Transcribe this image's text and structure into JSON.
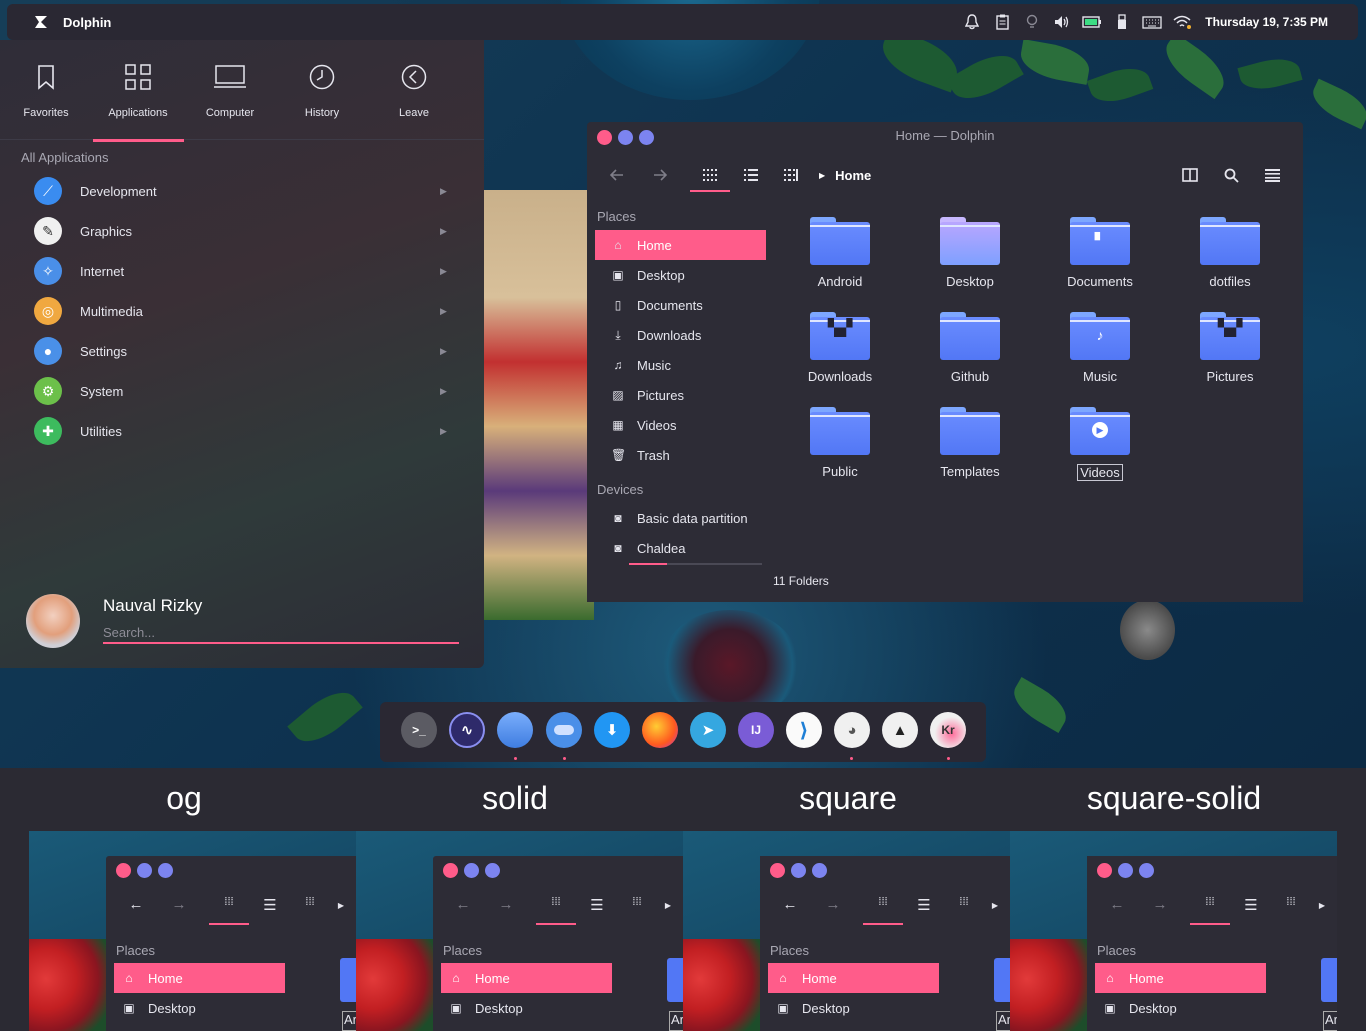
{
  "panel": {
    "app_title": "Dolphin",
    "clock": "Thursday 19,  7:35 PM",
    "tray_icons": [
      "bell-icon",
      "clipboard-icon",
      "lightbulb-icon",
      "volume-icon",
      "battery-icon",
      "usb-icon",
      "keyboard-icon",
      "wifi-icon"
    ]
  },
  "launcher": {
    "tabs": [
      {
        "label": "Favorites",
        "icon": "bookmark-icon"
      },
      {
        "label": "Applications",
        "icon": "grid-icon"
      },
      {
        "label": "Computer",
        "icon": "monitor-icon"
      },
      {
        "label": "History",
        "icon": "clock-icon"
      },
      {
        "label": "Leave",
        "icon": "back-circle-icon"
      }
    ],
    "active_tab": "Applications",
    "section_title": "All Applications",
    "categories": [
      {
        "label": "Development",
        "icon": "development-icon",
        "color": "#3a8cf0"
      },
      {
        "label": "Graphics",
        "icon": "graphics-icon",
        "color": "#f0f0f0"
      },
      {
        "label": "Internet",
        "icon": "internet-icon",
        "color": "#4a8fe8"
      },
      {
        "label": "Multimedia",
        "icon": "multimedia-icon",
        "color": "#f0a840"
      },
      {
        "label": "Settings",
        "icon": "settings-toggle-icon",
        "color": "#4a90e8"
      },
      {
        "label": "System",
        "icon": "system-gear-icon",
        "color": "#6cc04a"
      },
      {
        "label": "Utilities",
        "icon": "utilities-icon",
        "color": "#3dbb5e"
      }
    ],
    "user_name": "Nauval Rizky",
    "search_placeholder": "Search..."
  },
  "dolphin": {
    "window_title": "Home — Dolphin",
    "breadcrumb": "Home",
    "places_header": "Places",
    "places": [
      {
        "label": "Home",
        "icon": "home-icon"
      },
      {
        "label": "Desktop",
        "icon": "desktop-icon"
      },
      {
        "label": "Documents",
        "icon": "document-icon"
      },
      {
        "label": "Downloads",
        "icon": "download-icon"
      },
      {
        "label": "Music",
        "icon": "music-icon"
      },
      {
        "label": "Pictures",
        "icon": "picture-icon"
      },
      {
        "label": "Videos",
        "icon": "video-icon"
      },
      {
        "label": "Trash",
        "icon": "trash-icon"
      }
    ],
    "devices_header": "Devices",
    "devices": [
      {
        "label": "Basic data partition",
        "icon": "drive-icon"
      },
      {
        "label": "Chaldea",
        "icon": "drive-icon"
      }
    ],
    "folders": [
      {
        "label": "Android",
        "emblem": ""
      },
      {
        "label": "Desktop",
        "emblem": "desktop"
      },
      {
        "label": "Documents",
        "emblem": "document"
      },
      {
        "label": "dotfiles",
        "emblem": ""
      },
      {
        "label": "Downloads",
        "emblem": "images"
      },
      {
        "label": "Github",
        "emblem": ""
      },
      {
        "label": "Music",
        "emblem": "music"
      },
      {
        "label": "Pictures",
        "emblem": "images"
      },
      {
        "label": "Public",
        "emblem": ""
      },
      {
        "label": "Templates",
        "emblem": ""
      },
      {
        "label": "Videos",
        "emblem": "video"
      }
    ],
    "status": "11 Folders",
    "accent": "#ff5c8a",
    "folder_color": "#5277f5"
  },
  "dock": {
    "apps": [
      {
        "name": "terminal",
        "glyph": ">_",
        "color": "#5b5b63"
      },
      {
        "name": "system-monitor",
        "glyph": "∿",
        "color": "#3a3a7a"
      },
      {
        "name": "files",
        "glyph": "",
        "color": "#4a8fe8"
      },
      {
        "name": "settings",
        "glyph": "●",
        "color": "#4a8fe8"
      },
      {
        "name": "downloader",
        "glyph": "⬇",
        "color": "#2196f3"
      },
      {
        "name": "firefox",
        "glyph": "",
        "color": "#ff7a1a"
      },
      {
        "name": "telegram",
        "glyph": "➤",
        "color": "#35a7e0"
      },
      {
        "name": "intellij",
        "glyph": "IJ",
        "color": "#7a5cd6"
      },
      {
        "name": "vscode",
        "glyph": "⟩",
        "color": "#fafafa"
      },
      {
        "name": "gimp",
        "glyph": "◕",
        "color": "#f0f0f0"
      },
      {
        "name": "inkscape",
        "glyph": "▲",
        "color": "#f0f0f0"
      },
      {
        "name": "krita",
        "glyph": "Kr",
        "color": "#f0f0f0"
      }
    ]
  },
  "variants": [
    {
      "label": "og",
      "back_enabled": true
    },
    {
      "label": "solid",
      "back_enabled": false
    },
    {
      "label": "square",
      "back_enabled": true
    },
    {
      "label": "square-solid",
      "back_enabled": false
    }
  ],
  "variant_window": {
    "places_header": "Places",
    "home": "Home",
    "desktop": "Desktop",
    "folder_label_partial": "Ar"
  }
}
